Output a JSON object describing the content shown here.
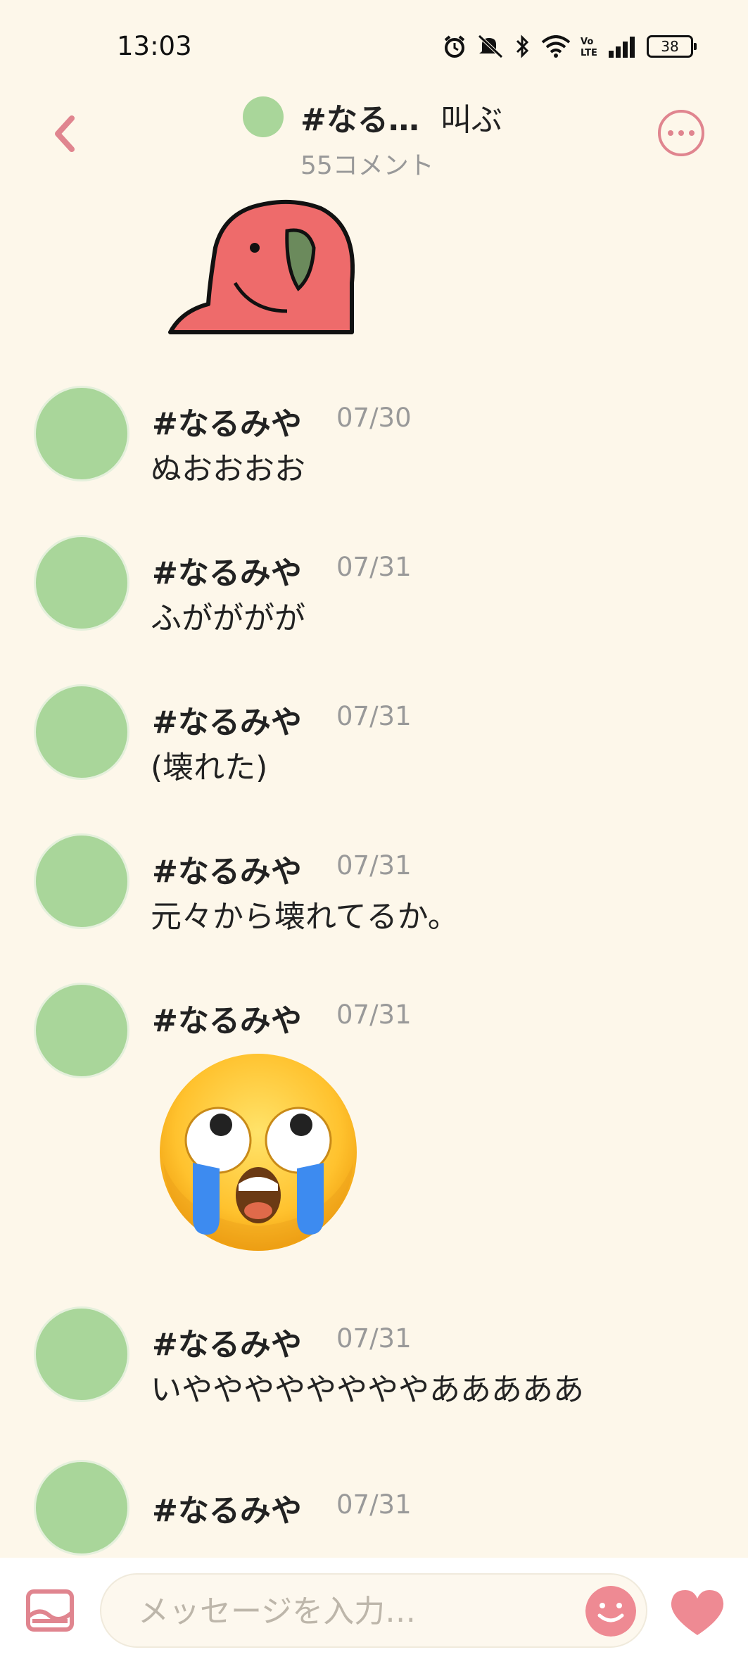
{
  "status_bar": {
    "time": "13:03",
    "battery": "38",
    "icons": [
      "alarm-icon",
      "mute-icon",
      "bluetooth-icon",
      "wifi-icon",
      "volte-icon",
      "signal-icon",
      "battery-icon"
    ]
  },
  "header": {
    "title": "#なる…",
    "title_extra": "叫ぶ",
    "subtitle": "55コメント",
    "icons": [
      "back-chevron-icon",
      "more-options-icon"
    ]
  },
  "colors": {
    "background": "#fdf7ea",
    "avatar": "#a9d69a",
    "accent_pink": "#e0858f",
    "muted_text": "#999999"
  },
  "messages": [
    {
      "author": "#なるみや",
      "date": "07/30",
      "text": "ぬおおおお"
    },
    {
      "author": "#なるみや",
      "date": "07/31",
      "text": "ふがががが"
    },
    {
      "author": "#なるみや",
      "date": "07/31",
      "text": "(壊れた)"
    },
    {
      "author": "#なるみや",
      "date": "07/31",
      "text": "元々から壊れてるか。"
    },
    {
      "author": "#なるみや",
      "date": "07/31",
      "text": "",
      "emoji": "crying-face-emoji"
    },
    {
      "author": "#なるみや",
      "date": "07/31",
      "text": "いややややややややあああああ"
    },
    {
      "author": "#なるみや",
      "date": "07/31",
      "text": ""
    }
  ],
  "input_bar": {
    "placeholder": "メッセージを入力…",
    "icons": [
      "image-icon",
      "smile-icon",
      "heart-icon"
    ]
  }
}
